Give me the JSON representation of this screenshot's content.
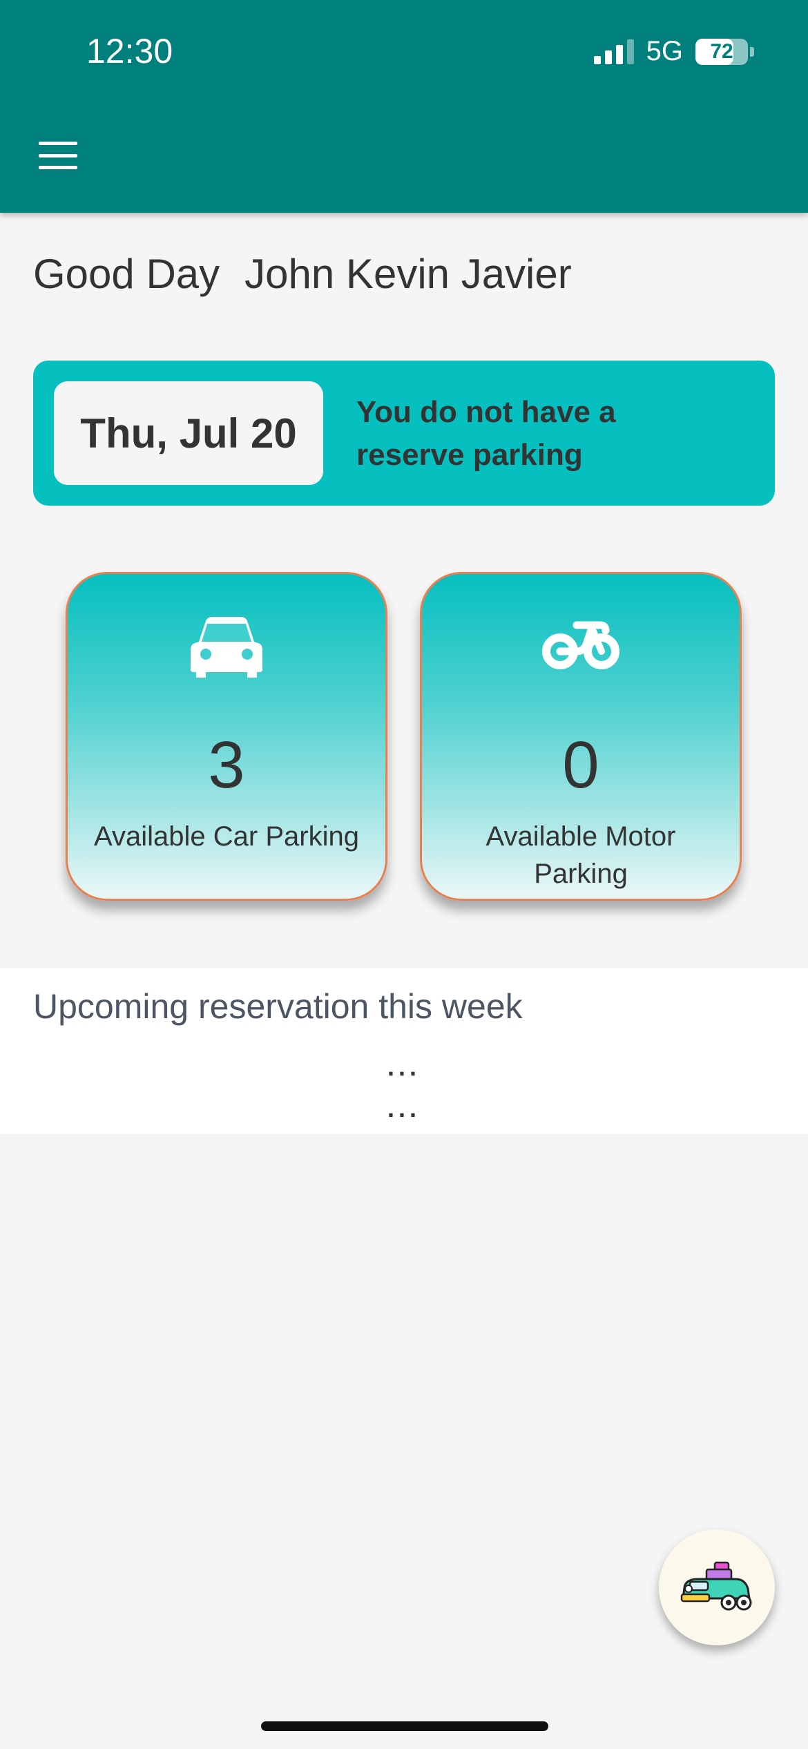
{
  "status_bar": {
    "time": "12:30",
    "network": "5G",
    "battery": "72",
    "battery_level": 0.72
  },
  "header": {
    "menu_icon": "hamburger-menu-icon"
  },
  "greeting": {
    "salutation": "Good Day",
    "name": "John Kevin Javier"
  },
  "banner": {
    "date": "Thu, Jul 20",
    "message": "You do not have a reserve parking"
  },
  "cards": [
    {
      "icon": "car-icon",
      "count": "3",
      "label": "Available Car Parking"
    },
    {
      "icon": "motorcycle-icon",
      "count": "0",
      "label": "Available Motor Parking"
    }
  ],
  "upcoming": {
    "title": "Upcoming reservation this week",
    "placeholder_1": "...",
    "placeholder_2": "..."
  },
  "fab": {
    "icon": "cartoon-car-icon"
  },
  "colors": {
    "primary": "#00807c",
    "accent": "#05c0bf",
    "card_border": "#e8804f",
    "background": "#f5f5f5"
  }
}
